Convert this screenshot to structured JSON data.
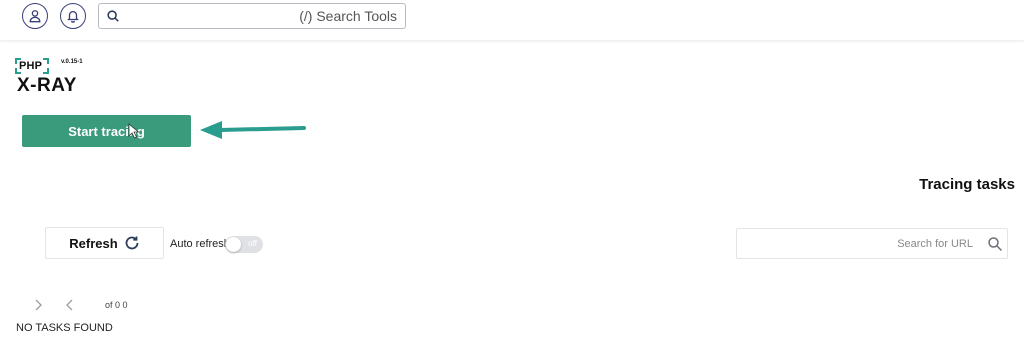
{
  "topbar": {
    "user_icon": "user-icon",
    "bell_icon": "bell-icon",
    "search_placeholder": "(/) Search Tools"
  },
  "logo": {
    "php": "PHP",
    "name": "X-RAY",
    "version": "v.0.15-1"
  },
  "actions": {
    "start_label": "Start tracing"
  },
  "tasks": {
    "title": "Tracing tasks",
    "refresh_label": "Refresh",
    "auto_refresh_label": "Auto refresh",
    "toggle_state": "off",
    "url_search_placeholder": "Search for URL",
    "pagination_text": "of 0 0",
    "empty_message": "NO TASKS FOUND"
  },
  "colors": {
    "accent": "#3a9a7c",
    "arrow": "#2a9d8f",
    "icon_outline": "#3b3f78"
  }
}
